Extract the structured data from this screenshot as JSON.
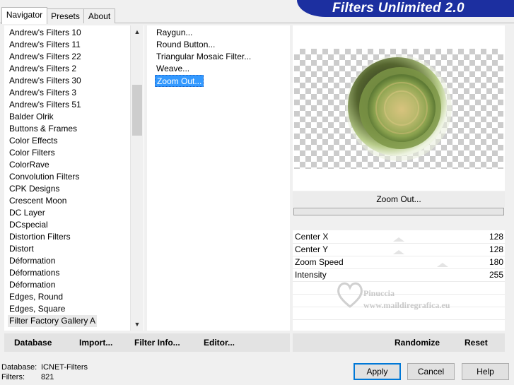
{
  "tabs": [
    {
      "label": "Navigator",
      "active": true
    },
    {
      "label": "Presets",
      "active": false
    },
    {
      "label": "About",
      "active": false
    }
  ],
  "banner_title": "Filters Unlimited 2.0",
  "categories": [
    {
      "label": "Andrew's Filters 10"
    },
    {
      "label": "Andrew's Filters 11"
    },
    {
      "label": "Andrew's Filters 22"
    },
    {
      "label": "Andrew's Filters 2"
    },
    {
      "label": "Andrew's Filters 30"
    },
    {
      "label": "Andrew's Filters 3"
    },
    {
      "label": "Andrew's Filters 51"
    },
    {
      "label": "Balder Olrik"
    },
    {
      "label": "Buttons & Frames"
    },
    {
      "label": "Color Effects"
    },
    {
      "label": "Color Filters"
    },
    {
      "label": "ColorRave"
    },
    {
      "label": "Convolution Filters"
    },
    {
      "label": "CPK Designs"
    },
    {
      "label": "Crescent Moon"
    },
    {
      "label": "DC Layer"
    },
    {
      "label": "DCspecial"
    },
    {
      "label": "Distortion Filters"
    },
    {
      "label": "Distort"
    },
    {
      "label": "Déformation"
    },
    {
      "label": "Déformations"
    },
    {
      "label": "Déformation"
    },
    {
      "label": "Edges, Round"
    },
    {
      "label": "Edges, Square"
    },
    {
      "label": "Filter Factory Gallery A"
    }
  ],
  "selected_category": "Filter Factory Gallery A",
  "filters": [
    {
      "label": "Raygun..."
    },
    {
      "label": "Round Button..."
    },
    {
      "label": "Triangular Mosaic Filter..."
    },
    {
      "label": "Weave..."
    },
    {
      "label": "Zoom Out..."
    }
  ],
  "selected_filter": "Zoom Out...",
  "filter_name_display": "Zoom Out...",
  "params": [
    {
      "name": "Center X",
      "value": "128"
    },
    {
      "name": "Center Y",
      "value": "128"
    },
    {
      "name": "Zoom Speed",
      "value": "180"
    },
    {
      "name": "Intensity",
      "value": "255"
    }
  ],
  "watermark": {
    "line1": "Pinuccia",
    "line2": "www.maildiregrafica.eu"
  },
  "left_bar_buttons": {
    "database": "Database",
    "import": "Import...",
    "filter_info": "Filter Info...",
    "editor": "Editor..."
  },
  "right_bar_buttons": {
    "randomize": "Randomize",
    "reset": "Reset"
  },
  "info": {
    "database_label": "Database:",
    "database_value": "ICNET-Filters",
    "filters_label": "Filters:",
    "filters_value": "821"
  },
  "dialog_buttons": {
    "apply": "Apply",
    "cancel": "Cancel",
    "help": "Help"
  },
  "icons": {
    "scroll_up": "▲",
    "scroll_down": "▼"
  },
  "colors": {
    "banner": "#1c2fa0",
    "selection": "#3399ff",
    "preview_sphere": "#b7c57a"
  }
}
